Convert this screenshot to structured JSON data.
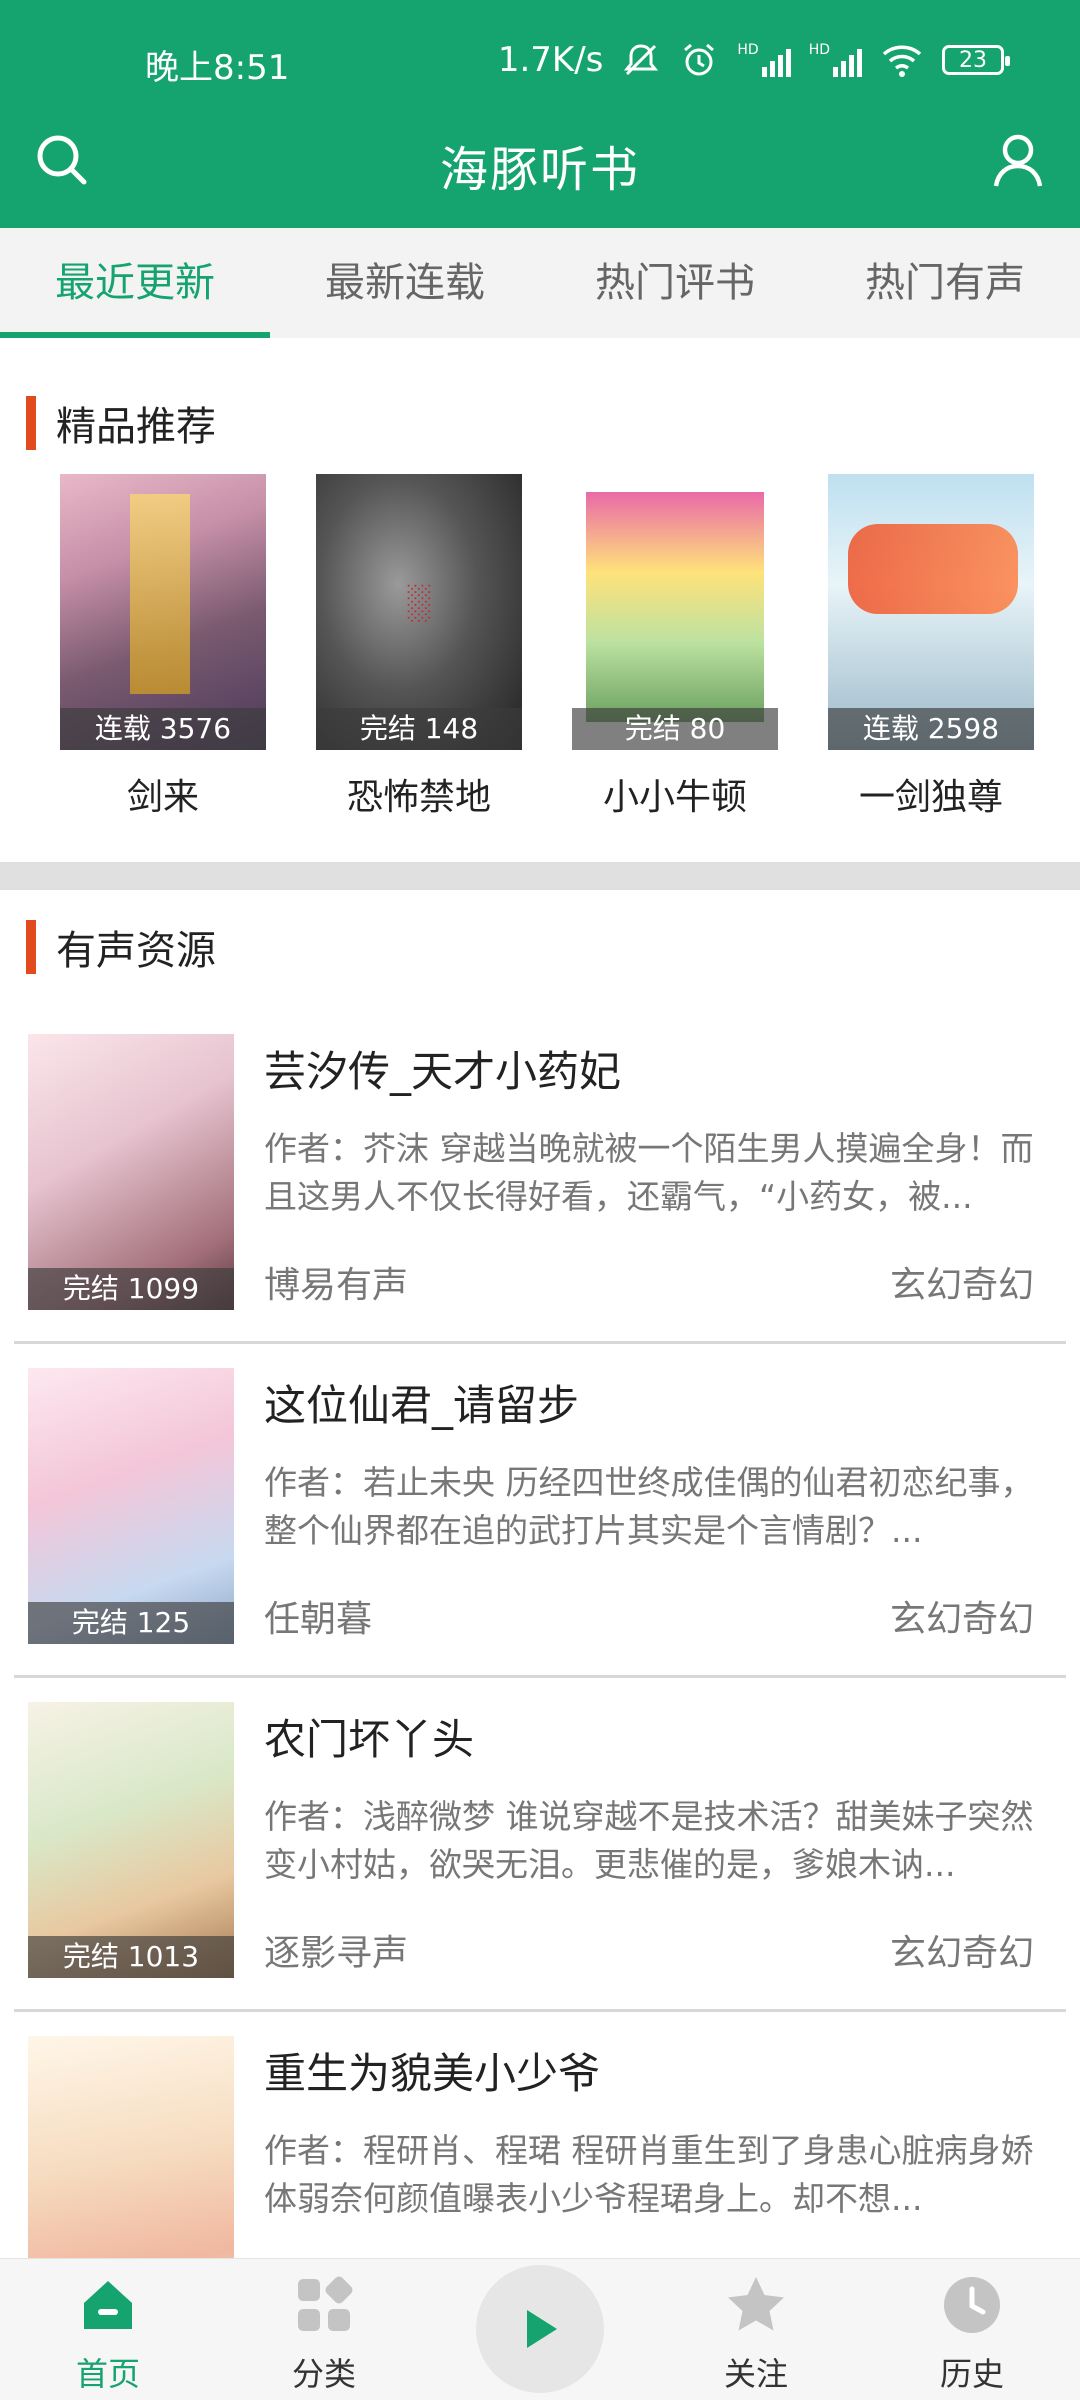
{
  "status_bar": {
    "time": "晚上8:51",
    "net_speed": "1.7K/s",
    "signal_1": "HD",
    "signal_2": "HD",
    "battery": "23"
  },
  "header": {
    "title": "海豚听书",
    "search_icon": "search-icon",
    "user_icon": "user-icon"
  },
  "tabs": [
    {
      "label": "最近更新",
      "active": true
    },
    {
      "label": "最新连载",
      "active": false
    },
    {
      "label": "热门评书",
      "active": false
    },
    {
      "label": "热门有声",
      "active": false
    }
  ],
  "recommend": {
    "title": "精品推荐",
    "items": [
      {
        "name": "剑来",
        "badge": "连载 3576"
      },
      {
        "name": "恐怖禁地",
        "badge": "完结 148"
      },
      {
        "name": "小小牛顿",
        "badge": "完结 80"
      },
      {
        "name": "一剑独尊",
        "badge": "连载 2598"
      }
    ]
  },
  "audio": {
    "title": "有声资源",
    "items": [
      {
        "name": "芸汐传_天才小药妃",
        "badge": "完结 1099",
        "desc": "作者：芥沫 穿越当晚就被一个陌生男人摸遍全身！而且这男人不仅长得好看，还霸气，“小药女，被...",
        "narrator": "博易有声",
        "category": "玄幻奇幻"
      },
      {
        "name": "这位仙君_请留步",
        "badge": "完结 125",
        "desc": "作者：若止未央 历经四世终成佳偶的仙君初恋纪事，整个仙界都在追的武打片其实是个言情剧？...",
        "narrator": "任朝暮",
        "category": "玄幻奇幻"
      },
      {
        "name": "农门坏丫头",
        "badge": "完结 1013",
        "desc": "作者：浅醉微梦 谁说穿越不是技术活？甜美妹子突然变小村姑，欲哭无泪。更悲催的是，爹娘木讷...",
        "narrator": "逐影寻声",
        "category": "玄幻奇幻"
      },
      {
        "name": "重生为貌美小少爷",
        "badge": "",
        "desc": "作者：程研肖、程珺 程研肖重生到了身患心脏病身娇体弱奈何颜值曝表小少爷程珺身上。却不想...",
        "narrator": "",
        "category": ""
      }
    ]
  },
  "bottom_nav": {
    "home": "首页",
    "category": "分类",
    "follow": "关注",
    "history": "历史",
    "accent": "#15a36f"
  },
  "colors": {
    "brand": "#15a36f",
    "section_marker": "#e14b1e"
  }
}
